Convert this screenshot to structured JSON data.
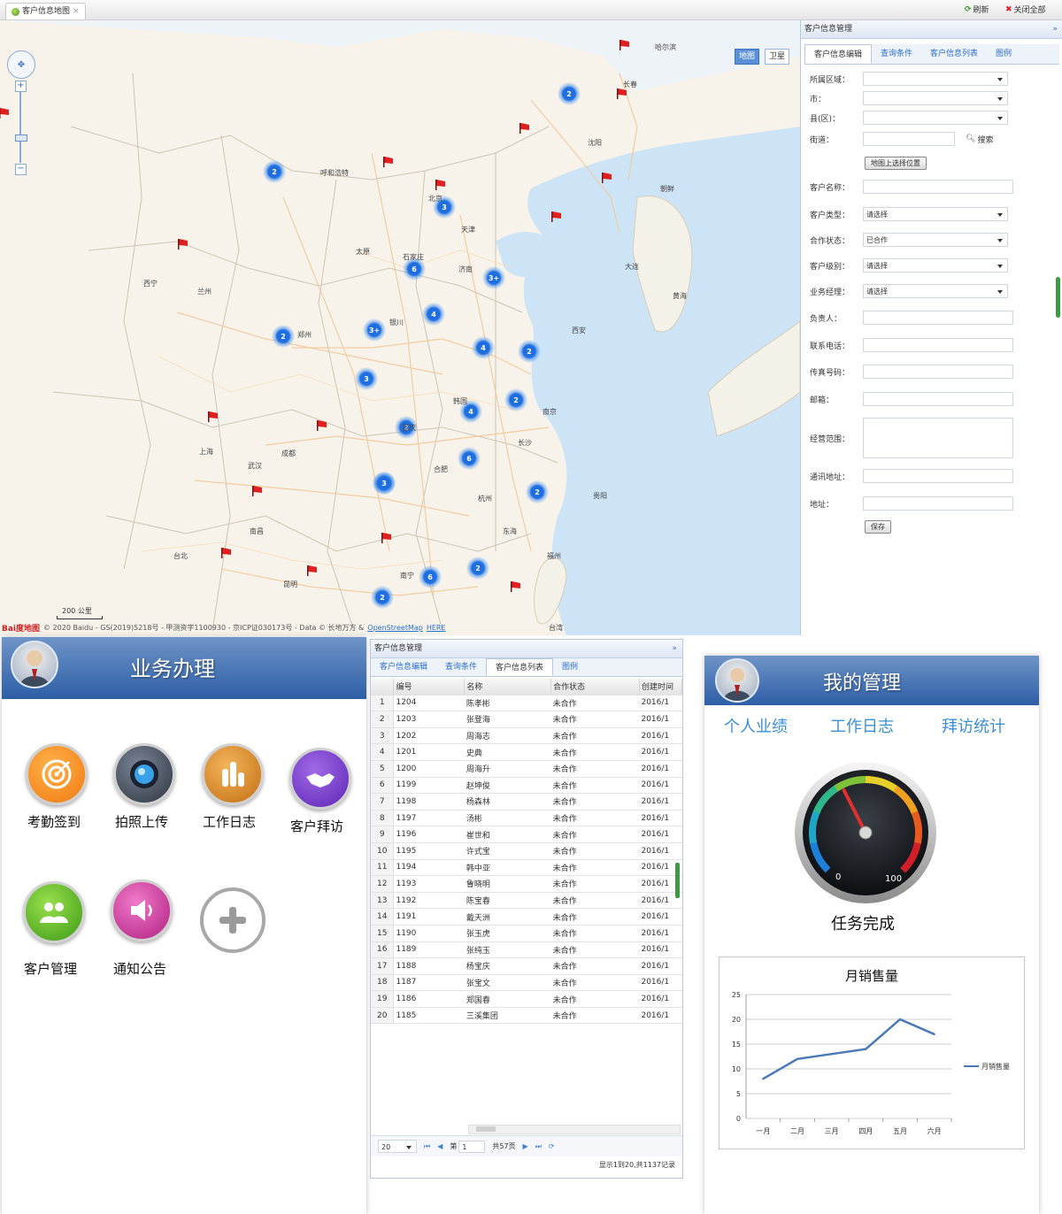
{
  "topbar": {
    "tab_label": "客户信息地图",
    "tab_close": "×",
    "refresh_label": "刷新",
    "close_all_label": "关闭全部"
  },
  "map": {
    "type_map": "地图",
    "type_satellite": "卫星",
    "scale_label": "200 公里",
    "copyright": "© 2020 Baidu - GS(2019)5218号 - 甲测资字1100930 - 京ICP证030173号 - Data © 长地万方 &",
    "osm_link": "OpenStreetMap",
    "here_link": "HERE",
    "logo": "Bai度地图",
    "clusters": [
      "2",
      "2",
      "3",
      "6",
      "3+",
      "4",
      "3+",
      "2",
      "4",
      "2",
      "3",
      "2",
      "4",
      "2",
      "6",
      "2",
      "2",
      "2",
      "6",
      "2",
      "3"
    ],
    "cities": [
      "哈尔滨",
      "长春",
      "呼和浩特",
      "沈阳",
      "北京",
      "天津",
      "朝鲜",
      "大连",
      "太原",
      "石家庄",
      "济南",
      "西宁",
      "兰州",
      "银川",
      "郑州",
      "西安",
      "黄海",
      "韩国",
      "合肥",
      "南京",
      "上海",
      "武汉",
      "成都",
      "重庆",
      "长沙",
      "杭州",
      "南昌",
      "贵阳",
      "东海",
      "福州",
      "台北",
      "昆明",
      "南宁",
      "台湾"
    ]
  },
  "customer_panel": {
    "title": "客户信息管理",
    "tabs": [
      "客户信息编辑",
      "查询条件",
      "客户信息列表",
      "图例"
    ],
    "fields": {
      "region": "所属区域：",
      "city": "市：",
      "district": "县(区)：",
      "street": "街道：",
      "search": "搜索",
      "pick_on_map": "地图上选择位置",
      "name": "客户名称：",
      "type": "客户类型：",
      "type_value": "请选择",
      "coop_status": "合作状态：",
      "coop_value": "已合作",
      "level": "客户级别：",
      "level_value": "请选择",
      "manager": "业务经理：",
      "manager_value": "请选择",
      "contact": "负责人：",
      "phone": "联系电话：",
      "fax": "传真号码：",
      "email": "邮箱：",
      "scope": "经营范围：",
      "mail_addr": "通讯地址：",
      "address": "地址：",
      "save": "保存"
    }
  },
  "business": {
    "title": "业务办理",
    "apps": [
      "考勤签到",
      "拍照上传",
      "工作日志",
      "客户拜访",
      "客户管理",
      "通知公告"
    ]
  },
  "grid": {
    "title": "客户信息管理",
    "tabs": [
      "客户信息编辑",
      "查询条件",
      "客户信息列表",
      "图例"
    ],
    "columns": [
      "编号",
      "名称",
      "合作状态",
      "创建时间"
    ],
    "rows": [
      [
        "1",
        "1204",
        "陈孝彬",
        "未合作",
        "2016/1"
      ],
      [
        "2",
        "1203",
        "张登海",
        "未合作",
        "2016/1"
      ],
      [
        "3",
        "1202",
        "周海志",
        "未合作",
        "2016/1"
      ],
      [
        "4",
        "1201",
        "史典",
        "未合作",
        "2016/1"
      ],
      [
        "5",
        "1200",
        "周海升",
        "未合作",
        "2016/1"
      ],
      [
        "6",
        "1199",
        "赵坤俊",
        "未合作",
        "2016/1"
      ],
      [
        "7",
        "1198",
        "杨森林",
        "未合作",
        "2016/1"
      ],
      [
        "8",
        "1197",
        "汤彬",
        "未合作",
        "2016/1"
      ],
      [
        "9",
        "1196",
        "崔世和",
        "未合作",
        "2016/1"
      ],
      [
        "10",
        "1195",
        "许式宝",
        "未合作",
        "2016/1"
      ],
      [
        "11",
        "1194",
        "韩中亚",
        "未合作",
        "2016/1"
      ],
      [
        "12",
        "1193",
        "鲁晓明",
        "未合作",
        "2016/1"
      ],
      [
        "13",
        "1192",
        "陈宝春",
        "未合作",
        "2016/1"
      ],
      [
        "14",
        "1191",
        "戴天洲",
        "未合作",
        "2016/1"
      ],
      [
        "15",
        "1190",
        "张玉虎",
        "未合作",
        "2016/1"
      ],
      [
        "16",
        "1189",
        "张纯玉",
        "未合作",
        "2016/1"
      ],
      [
        "17",
        "1188",
        "杨宝庆",
        "未合作",
        "2016/1"
      ],
      [
        "18",
        "1187",
        "张宝文",
        "未合作",
        "2016/1"
      ],
      [
        "19",
        "1186",
        "郑国春",
        "未合作",
        "2016/1"
      ],
      [
        "20",
        "1185",
        "三溪集团",
        "未合作",
        "2016/1"
      ]
    ],
    "pager": {
      "page_size": "20",
      "page_prefix": "第",
      "page_value": "1",
      "page_total": "共57页",
      "summary": "显示1到20,共1137记录"
    }
  },
  "management": {
    "title": "我的管理",
    "tabs": [
      "个人业绩",
      "工作日志",
      "拜访统计"
    ],
    "gauge": {
      "min_label": "0",
      "max_label": "100",
      "value": 40,
      "caption": "任务完成"
    }
  },
  "chart_data": {
    "type": "line",
    "title": "月销售量",
    "categories": [
      "一月",
      "二月",
      "三月",
      "四月",
      "五月",
      "六月"
    ],
    "series": [
      {
        "name": "月销售量",
        "values": [
          8,
          12,
          13,
          14,
          20,
          17
        ]
      }
    ],
    "ylim": [
      0,
      25
    ],
    "yticks": [
      "0",
      "5",
      "10",
      "15",
      "20",
      "25"
    ],
    "legend_position": "right",
    "grid": true,
    "color": "#4a7ab8"
  }
}
